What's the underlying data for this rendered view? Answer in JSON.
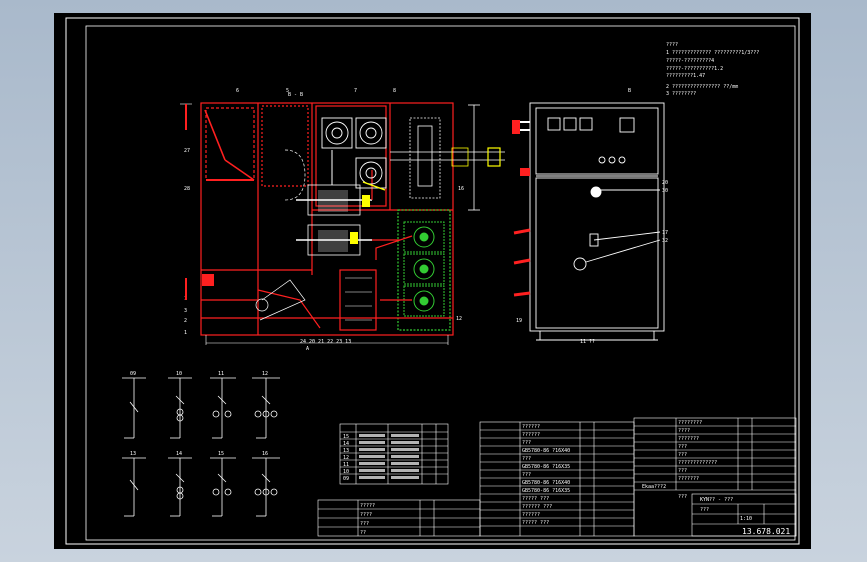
{
  "drawing": {
    "section_label": "B - B",
    "mark_b": "B",
    "notes_title": "????",
    "notes": [
      "1   ?????????????     ?????????1/3???",
      "     ?????-?????????4",
      "     ?????-??????????1.2",
      "                        ?????????1.47",
      "2   ????????????????     ??/mm",
      "3   ????????"
    ],
    "left_balloons": [
      "27",
      "28",
      "1",
      "3",
      "2",
      "1"
    ],
    "top_balloons": [
      "6",
      "5",
      "7",
      "8"
    ],
    "right_balloons": [
      "16",
      "12",
      "19"
    ],
    "bottom_balloons": "24 20 21 22 23  13",
    "front_balloons": [
      "20",
      "30",
      "17",
      "32"
    ],
    "bottom_mark": "A",
    "front_bottom_mark": "11 ??",
    "circuit_numbers": [
      "09",
      "10",
      "11",
      "12",
      "13",
      "14",
      "15",
      "16"
    ],
    "parts_table_rows": [
      "15",
      "14",
      "13",
      "12",
      "11",
      "10",
      "09",
      "08"
    ],
    "drawing_number": "13.678.021",
    "title_block_name": "KYN?? - ???",
    "title_block_sub": "???",
    "title_block_scale": "1:10",
    "bom_left_items": [
      "?????",
      "????",
      "???",
      "??"
    ],
    "bom_mid_items": [
      "??????",
      "??????",
      "???",
      "GB5780-86  ?16X40",
      "???",
      "GB5780-86 ?16X35",
      "???",
      "GB5780-86 ?16X40",
      "GB5780-86 ?16X35",
      "????? ???",
      "?????? ???",
      "??????",
      "????? ???"
    ],
    "bom_right_items": [
      "????????",
      "????",
      "???????",
      "???",
      "???",
      "?????????????",
      "???",
      "???????",
      "Ekaa???2",
      "???"
    ]
  },
  "colors": {
    "sheet": "#000000",
    "cabinet": "#ff2020",
    "busbar": "#ffffff",
    "ct": "#33cc33",
    "accent": "#ffff00"
  }
}
